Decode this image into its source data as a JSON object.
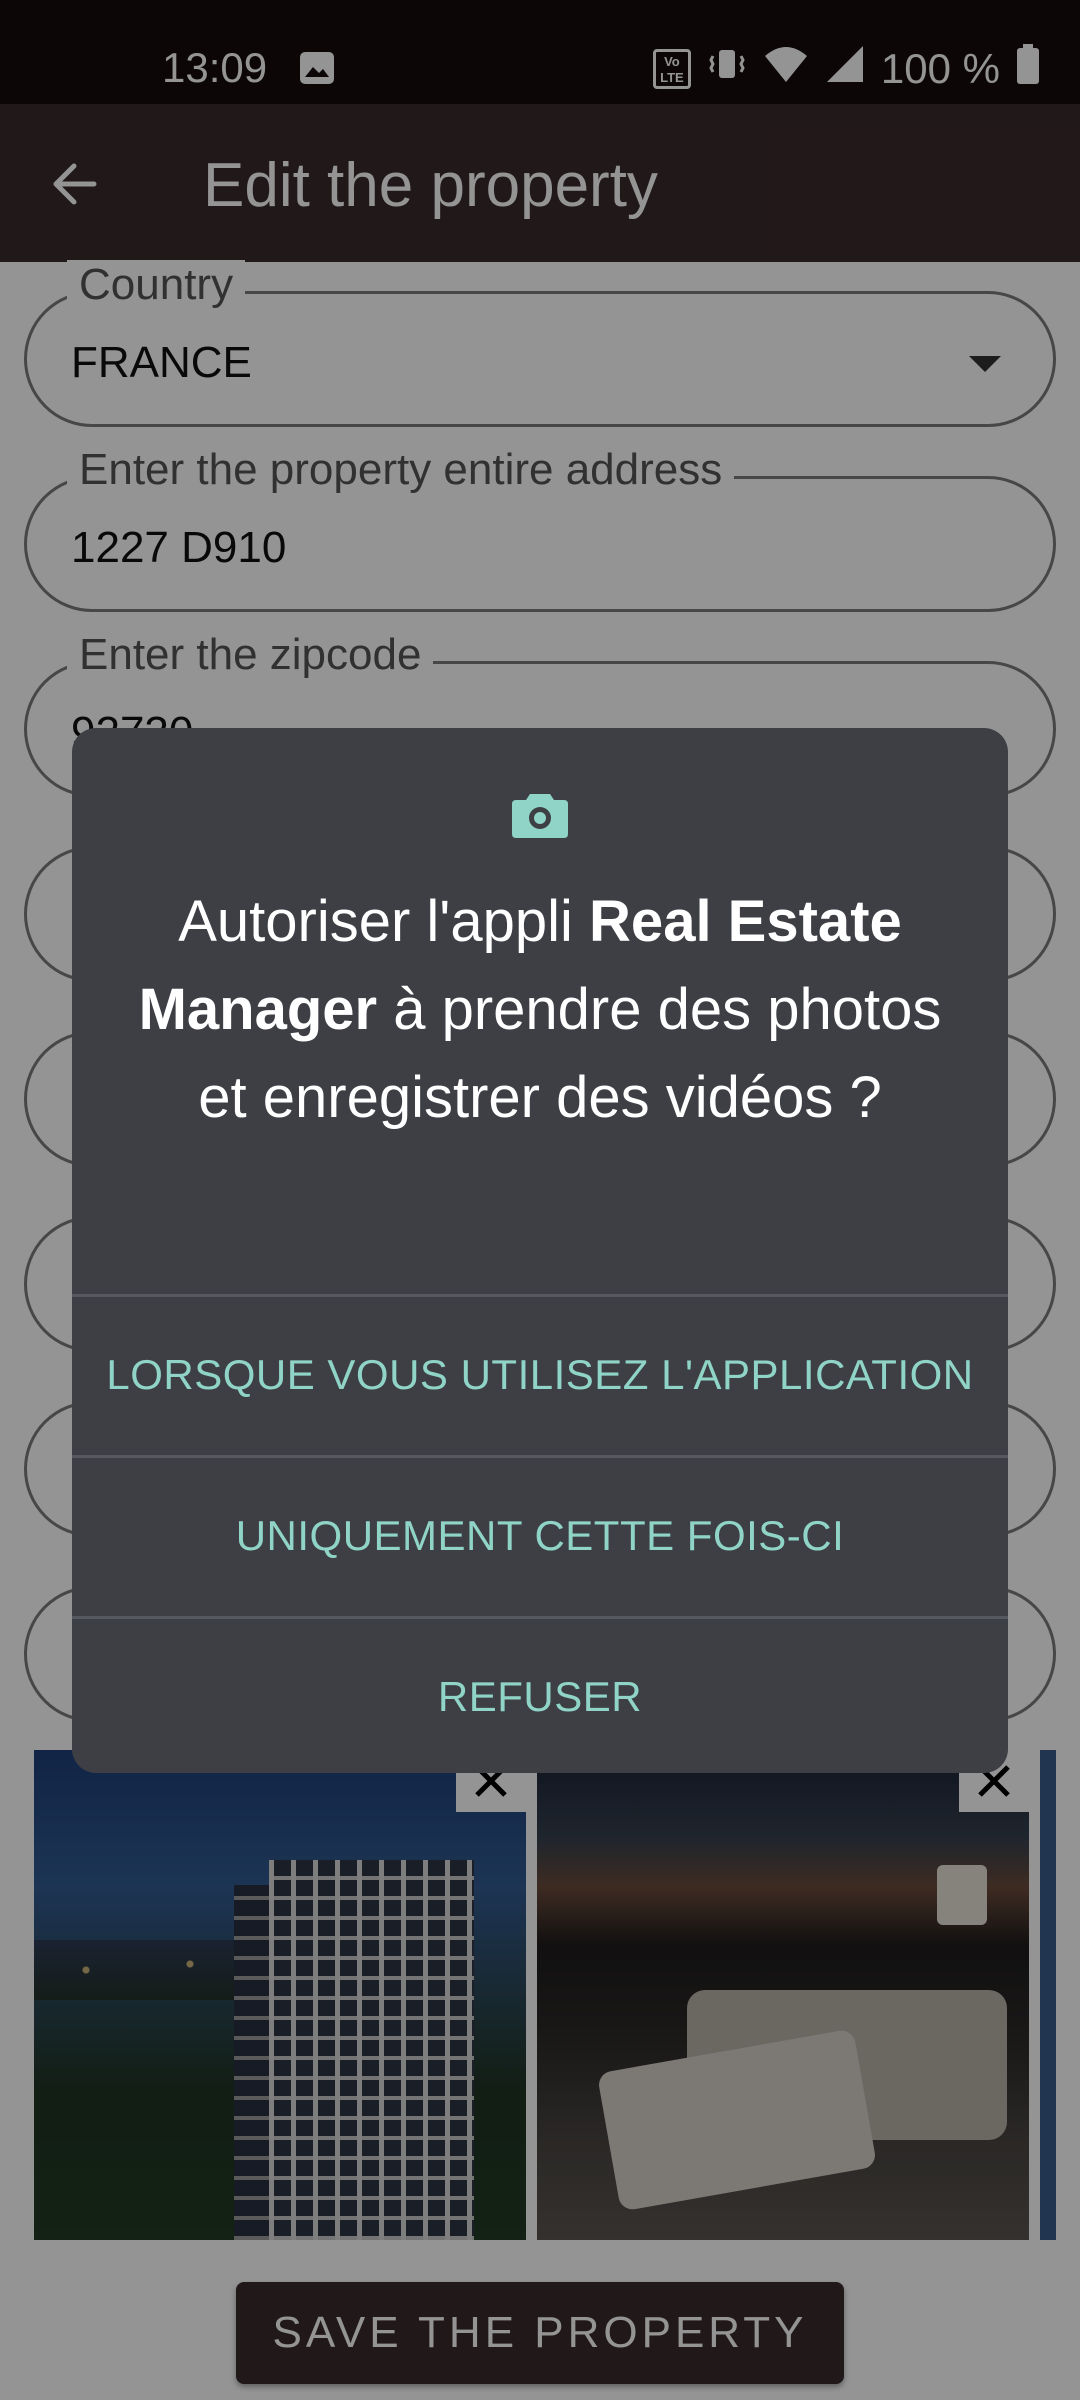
{
  "status_bar": {
    "time": "13:09",
    "volte_label": "Vo LTE",
    "battery_text": "100 %",
    "icons": [
      "image-icon",
      "volte-icon",
      "vibrate-icon",
      "wifi-icon",
      "signal-icon",
      "battery-icon"
    ]
  },
  "app_bar": {
    "title": "Edit the property",
    "back_icon": "arrow-back-icon"
  },
  "form": {
    "country": {
      "label": "Country",
      "value": "FRANCE"
    },
    "address": {
      "label": "Enter the property entire address",
      "value": "1227 D910"
    },
    "zipcode": {
      "label": "Enter the zipcode",
      "value": "92730"
    }
  },
  "photos": {
    "remove_icon": "close-icon"
  },
  "save_button": "SAVE THE PROPERTY",
  "dialog": {
    "icon": "camera-icon",
    "message_prefix": "Autoriser l'appli ",
    "app_name": "Real Estate Manager",
    "message_suffix": " à prendre des photos et enregistrer des vidéos ?",
    "option_while_using": "LORSQUE VOUS UTILISEZ L'APPLICATION",
    "option_once": "UNIQUEMENT CETTE FOIS-CI",
    "option_deny": "REFUSER"
  },
  "colors": {
    "status_bar_bg": "#160b0c",
    "app_bar_bg": "#3a2a2b",
    "dialog_bg": "#3d3f45",
    "dialog_accent": "#8fd4c6",
    "scrim": "rgba(0,0,0,0.42)"
  }
}
